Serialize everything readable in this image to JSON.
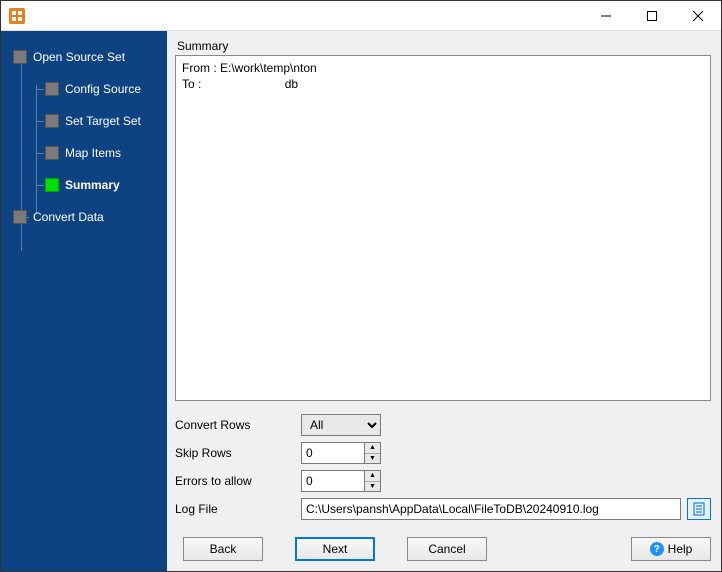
{
  "sidebar": {
    "items": [
      {
        "label": "Open Source Set",
        "level": 0
      },
      {
        "label": "Config Source",
        "level": 1
      },
      {
        "label": "Set Target Set",
        "level": 1
      },
      {
        "label": "Map Items",
        "level": 1
      },
      {
        "label": "Summary",
        "level": 1,
        "active": true
      },
      {
        "label": "Convert Data",
        "level": 0
      }
    ]
  },
  "main": {
    "summary_label": "Summary",
    "summary_text": "From : E:\\work\\temp\\nton\nTo :                         db",
    "convert_rows_label": "Convert Rows",
    "convert_rows_value": "All",
    "skip_rows_label": "Skip Rows",
    "skip_rows_value": "0",
    "errors_allow_label": "Errors to allow",
    "errors_allow_value": "0",
    "log_file_label": "Log File",
    "log_file_value": "C:\\Users\\pansh\\AppData\\Local\\FileToDB\\20240910.log"
  },
  "buttons": {
    "back": "Back",
    "next": "Next",
    "cancel": "Cancel",
    "help": "Help"
  }
}
